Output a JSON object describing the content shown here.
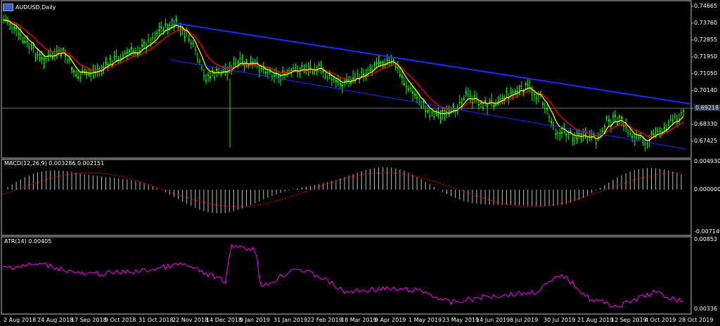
{
  "chart": {
    "symbol_label": "AUDUSD,Daily",
    "current_price": "0.69218",
    "colors": {
      "background": "#000000",
      "frame": "#c0c0c0",
      "candle": "#00ff00",
      "ma_fast": "#ffff00",
      "ma_slow": "#ff0000",
      "channel": "#1f2bff",
      "macd_hist": "#c0c0c0",
      "macd_signal": "#ff0000",
      "atr": "#ff00ff"
    }
  },
  "price_axis": [
    "0.74665",
    "0.73760",
    "0.72855",
    "0.71950",
    "0.71050",
    "0.70140",
    "0.69218",
    "0.68330",
    "0.67425"
  ],
  "macd": {
    "label": "MACD(12,26,9) 0.003286 0.002151",
    "axis": [
      "0.004930",
      "0.000000",
      "-0.007146"
    ]
  },
  "atr": {
    "label": "ATR(14) 0.00405",
    "axis": [
      "0.00853",
      "0.00336"
    ]
  },
  "time_axis": [
    "2 Aug 2018",
    "24 Aug 2018",
    "17 Sep 2018",
    "9 Oct 2018",
    "31 Oct 2018",
    "22 Nov 2018",
    "14 Dec 2018",
    "9 Jan 2019",
    "31 Jan 2019",
    "22 Feb 2019",
    "18 Mar 2019",
    "9 Apr 2019",
    "1 May 2019",
    "23 May 2019",
    "14 Jun 2019",
    "8 Jul 2019",
    "30 Jul 2019",
    "21 Aug 2019",
    "12 Sep 2019",
    "4 Oct 2019",
    "28 Oct 2019"
  ]
}
